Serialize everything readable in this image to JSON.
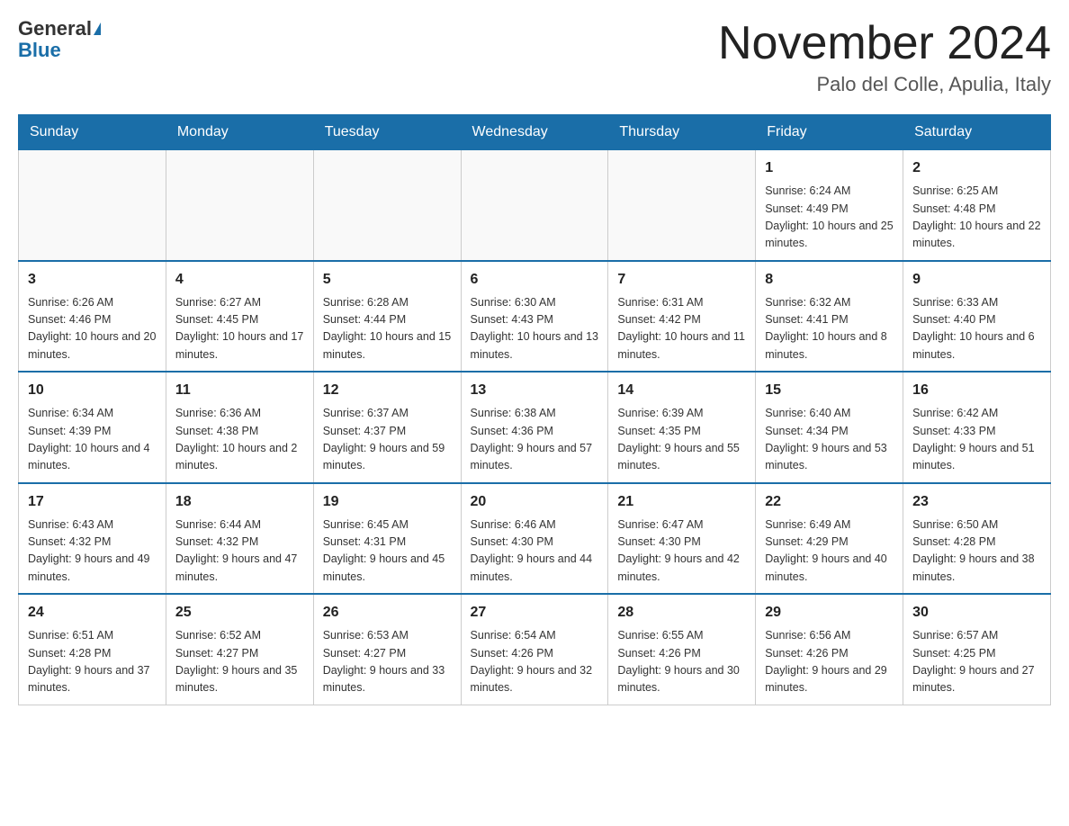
{
  "header": {
    "logo_general": "General",
    "logo_blue": "Blue",
    "month_title": "November 2024",
    "location": "Palo del Colle, Apulia, Italy"
  },
  "weekdays": [
    "Sunday",
    "Monday",
    "Tuesday",
    "Wednesday",
    "Thursday",
    "Friday",
    "Saturday"
  ],
  "weeks": [
    {
      "days": [
        {
          "num": "",
          "info": ""
        },
        {
          "num": "",
          "info": ""
        },
        {
          "num": "",
          "info": ""
        },
        {
          "num": "",
          "info": ""
        },
        {
          "num": "",
          "info": ""
        },
        {
          "num": "1",
          "info": "Sunrise: 6:24 AM\nSunset: 4:49 PM\nDaylight: 10 hours and 25 minutes."
        },
        {
          "num": "2",
          "info": "Sunrise: 6:25 AM\nSunset: 4:48 PM\nDaylight: 10 hours and 22 minutes."
        }
      ]
    },
    {
      "days": [
        {
          "num": "3",
          "info": "Sunrise: 6:26 AM\nSunset: 4:46 PM\nDaylight: 10 hours and 20 minutes."
        },
        {
          "num": "4",
          "info": "Sunrise: 6:27 AM\nSunset: 4:45 PM\nDaylight: 10 hours and 17 minutes."
        },
        {
          "num": "5",
          "info": "Sunrise: 6:28 AM\nSunset: 4:44 PM\nDaylight: 10 hours and 15 minutes."
        },
        {
          "num": "6",
          "info": "Sunrise: 6:30 AM\nSunset: 4:43 PM\nDaylight: 10 hours and 13 minutes."
        },
        {
          "num": "7",
          "info": "Sunrise: 6:31 AM\nSunset: 4:42 PM\nDaylight: 10 hours and 11 minutes."
        },
        {
          "num": "8",
          "info": "Sunrise: 6:32 AM\nSunset: 4:41 PM\nDaylight: 10 hours and 8 minutes."
        },
        {
          "num": "9",
          "info": "Sunrise: 6:33 AM\nSunset: 4:40 PM\nDaylight: 10 hours and 6 minutes."
        }
      ]
    },
    {
      "days": [
        {
          "num": "10",
          "info": "Sunrise: 6:34 AM\nSunset: 4:39 PM\nDaylight: 10 hours and 4 minutes."
        },
        {
          "num": "11",
          "info": "Sunrise: 6:36 AM\nSunset: 4:38 PM\nDaylight: 10 hours and 2 minutes."
        },
        {
          "num": "12",
          "info": "Sunrise: 6:37 AM\nSunset: 4:37 PM\nDaylight: 9 hours and 59 minutes."
        },
        {
          "num": "13",
          "info": "Sunrise: 6:38 AM\nSunset: 4:36 PM\nDaylight: 9 hours and 57 minutes."
        },
        {
          "num": "14",
          "info": "Sunrise: 6:39 AM\nSunset: 4:35 PM\nDaylight: 9 hours and 55 minutes."
        },
        {
          "num": "15",
          "info": "Sunrise: 6:40 AM\nSunset: 4:34 PM\nDaylight: 9 hours and 53 minutes."
        },
        {
          "num": "16",
          "info": "Sunrise: 6:42 AM\nSunset: 4:33 PM\nDaylight: 9 hours and 51 minutes."
        }
      ]
    },
    {
      "days": [
        {
          "num": "17",
          "info": "Sunrise: 6:43 AM\nSunset: 4:32 PM\nDaylight: 9 hours and 49 minutes."
        },
        {
          "num": "18",
          "info": "Sunrise: 6:44 AM\nSunset: 4:32 PM\nDaylight: 9 hours and 47 minutes."
        },
        {
          "num": "19",
          "info": "Sunrise: 6:45 AM\nSunset: 4:31 PM\nDaylight: 9 hours and 45 minutes."
        },
        {
          "num": "20",
          "info": "Sunrise: 6:46 AM\nSunset: 4:30 PM\nDaylight: 9 hours and 44 minutes."
        },
        {
          "num": "21",
          "info": "Sunrise: 6:47 AM\nSunset: 4:30 PM\nDaylight: 9 hours and 42 minutes."
        },
        {
          "num": "22",
          "info": "Sunrise: 6:49 AM\nSunset: 4:29 PM\nDaylight: 9 hours and 40 minutes."
        },
        {
          "num": "23",
          "info": "Sunrise: 6:50 AM\nSunset: 4:28 PM\nDaylight: 9 hours and 38 minutes."
        }
      ]
    },
    {
      "days": [
        {
          "num": "24",
          "info": "Sunrise: 6:51 AM\nSunset: 4:28 PM\nDaylight: 9 hours and 37 minutes."
        },
        {
          "num": "25",
          "info": "Sunrise: 6:52 AM\nSunset: 4:27 PM\nDaylight: 9 hours and 35 minutes."
        },
        {
          "num": "26",
          "info": "Sunrise: 6:53 AM\nSunset: 4:27 PM\nDaylight: 9 hours and 33 minutes."
        },
        {
          "num": "27",
          "info": "Sunrise: 6:54 AM\nSunset: 4:26 PM\nDaylight: 9 hours and 32 minutes."
        },
        {
          "num": "28",
          "info": "Sunrise: 6:55 AM\nSunset: 4:26 PM\nDaylight: 9 hours and 30 minutes."
        },
        {
          "num": "29",
          "info": "Sunrise: 6:56 AM\nSunset: 4:26 PM\nDaylight: 9 hours and 29 minutes."
        },
        {
          "num": "30",
          "info": "Sunrise: 6:57 AM\nSunset: 4:25 PM\nDaylight: 9 hours and 27 minutes."
        }
      ]
    }
  ]
}
